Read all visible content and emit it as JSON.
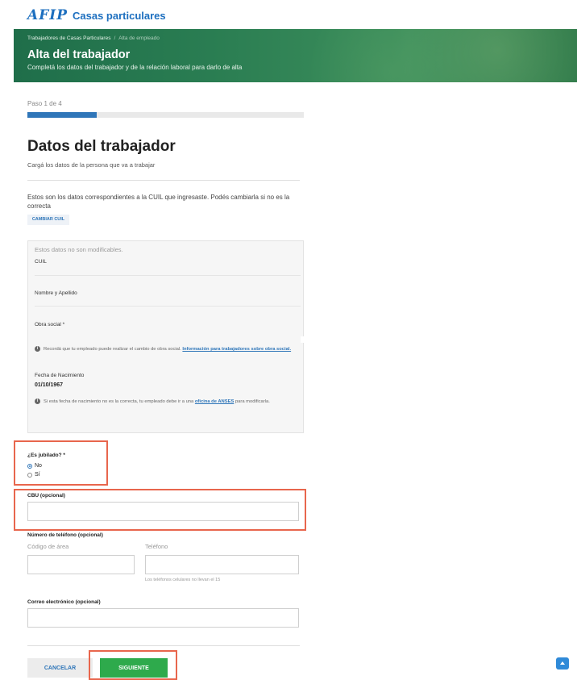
{
  "header": {
    "logo_mark": "AFIP",
    "app_name": "Casas particulares"
  },
  "banner": {
    "breadcrumb": [
      "Trabajadores de Casas Particulares",
      "Alta de empleado"
    ],
    "breadcrumb_sep": "/",
    "title": "Alta del trabajador",
    "subtitle": "Completá los datos del trabajador y de la relación laboral para darlo de alta"
  },
  "progress": {
    "label": "Paso 1 de 4",
    "current_step": 1,
    "total_steps": 4,
    "fill_fraction": 0.25,
    "color": "#2f76b9"
  },
  "section": {
    "title": "Datos del trabajador",
    "subtitle": "Cargá los datos de la persona que va a trabajar"
  },
  "cuil_info": {
    "text": "Estos son los datos correspondientes a la CUIL que ingresaste. Podés cambiarla si no es la correcta",
    "change_button": "CAMBIAR CUIL"
  },
  "readonly": {
    "note": "Estos datos no son modificables.",
    "cuil_label": "CUIL",
    "name_label": "Nombre y Apellido",
    "obra_social_label": "Obra social *",
    "obra_hint_text": "Recordá que tu empleado puede realizar el cambio de obra social.",
    "obra_hint_link": "Información para trabajadores sobre obra social.",
    "dob_label": "Fecha de Nacimiento",
    "dob_value": "01/10/1967",
    "dob_hint_text": "Si esta fecha de nacimiento no es la correcta, tu empleado debe ir a una",
    "dob_hint_link": "oficina de ANSES",
    "dob_hint_tail": "para modificarla."
  },
  "jubilado": {
    "label": "¿Es jubilado? *",
    "options": [
      "No",
      "Sí"
    ],
    "selected": "No"
  },
  "cbu": {
    "label": "CBU (opcional)",
    "value": ""
  },
  "phone": {
    "label": "Número de teléfono (opcional)",
    "area_label": "Código de área",
    "number_label": "Teléfono",
    "helper": "Los teléfonos celulares no llevan el 15"
  },
  "email": {
    "label": "Correo electrónico (opcional)",
    "value": ""
  },
  "actions": {
    "cancel": "CANCELAR",
    "next": "SIGUIENTE"
  },
  "colors": {
    "primary": "#2f76b9",
    "success": "#2eaa4c",
    "highlight": "#e8664d",
    "banner": "#2a7d52"
  },
  "icons": {
    "info": "info-circle-icon",
    "back_to_top": "arrow-up-icon"
  }
}
